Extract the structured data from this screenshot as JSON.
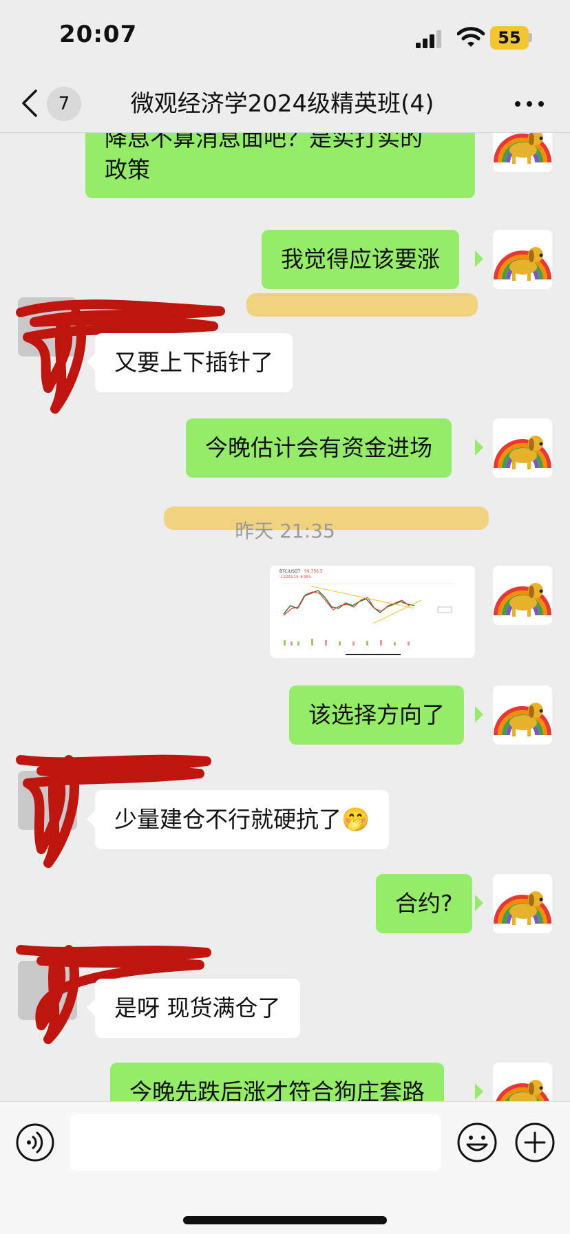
{
  "status_bar": {
    "time": "20:07",
    "battery_level": "55"
  },
  "nav": {
    "unread_count": "7",
    "title": "微观经济学2024级精英班(4)"
  },
  "messages": [
    {
      "side": "me",
      "text_line1": "降息不算消息面吧？是实打实的",
      "text_line2": "政策"
    },
    {
      "side": "me",
      "text": "我觉得应该要涨"
    },
    {
      "side": "other",
      "text": "又要上下插针了"
    },
    {
      "side": "me",
      "text": "今晚估计会有资金进场"
    },
    {
      "type": "time",
      "text": "昨天 21:35"
    },
    {
      "side": "me",
      "type": "image",
      "image": {
        "pair": "BTC/USDT",
        "price": "59,756.5",
        "change": "-1,0259.19 -8.95%"
      }
    },
    {
      "side": "me",
      "text": "该选择方向了"
    },
    {
      "side": "other",
      "text": "少量建仓不行就硬抗了🤭"
    },
    {
      "side": "me",
      "text": "合约?"
    },
    {
      "side": "other",
      "text": "是呀  现货满仓了"
    },
    {
      "side": "me",
      "text": "今晚先跌后涨才符合狗庄套路"
    }
  ],
  "input": {
    "placeholder": ""
  },
  "colors": {
    "my_bubble": "#95ec69",
    "other_bubble": "#ffffff",
    "background": "#ededed",
    "highlight": "#f0c85a",
    "redaction": "#c0150e"
  },
  "icons": [
    "back-icon",
    "more-icon",
    "voice-icon",
    "emoji-icon",
    "plus-icon",
    "signal-icon",
    "wifi-icon"
  ]
}
